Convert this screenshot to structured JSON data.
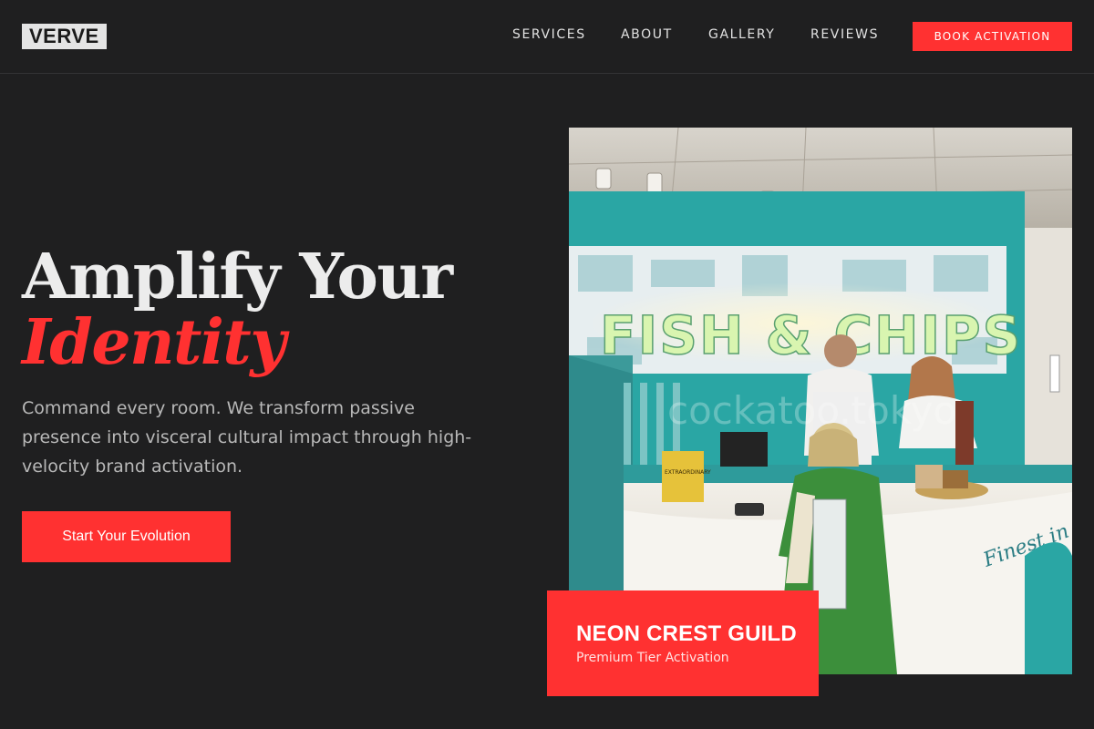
{
  "brand": {
    "logo": "VERVE"
  },
  "nav": {
    "links": [
      "SERVICES",
      "ABOUT",
      "GALLERY",
      "REVIEWS"
    ],
    "cta": "BOOK ACTIVATION"
  },
  "hero": {
    "title_line1": "Amplify Your",
    "title_line2": "Identity",
    "subtitle": "Command every room. We transform passive presence into visceral cultural impact through high-velocity brand activation.",
    "cta": "Start Your Evolution"
  },
  "photo": {
    "sign_text": "FISH & CHIPS",
    "watermark": "cockatoo.tokyo",
    "van_script": "Finest in London",
    "poster_text": "EXTRAORDINARY"
  },
  "card": {
    "title": "NEON CREST GUILD",
    "subtitle": "Premium Tier Activation"
  },
  "colors": {
    "accent": "#ff3131",
    "background": "#1f1f20",
    "teal": "#2aa6a4"
  }
}
